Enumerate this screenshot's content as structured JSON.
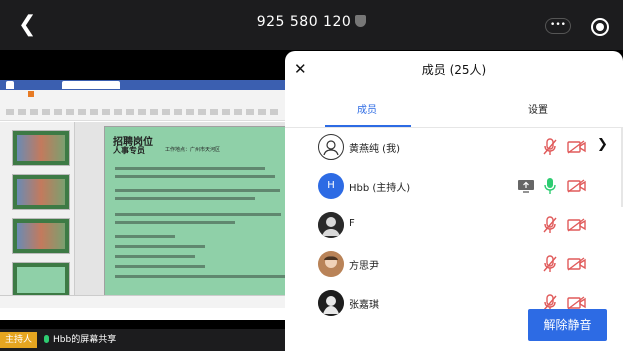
{
  "topbar": {
    "meeting_id": "925 580 120",
    "more_label": "•••"
  },
  "share": {
    "host_badge": "主持人",
    "share_text": "Hbb的屏幕共享",
    "slide": {
      "title": "招聘岗位",
      "subtitle": "人事专员",
      "location": "工作地点：广州市天河区"
    }
  },
  "panel": {
    "title": "成员 (25人)",
    "tabs": [
      {
        "label": "成员"
      },
      {
        "label": "设置"
      }
    ],
    "members": [
      {
        "name": "黄燕纯 (我)",
        "avatar_text": "",
        "mic": "off",
        "camera": "off",
        "sharing": false,
        "has_chevron": true
      },
      {
        "name": "Hbb (主持人)",
        "avatar_text": "H",
        "mic": "on",
        "camera": "off",
        "sharing": true,
        "has_chevron": false
      },
      {
        "name": "F",
        "avatar_text": "",
        "mic": "off",
        "camera": "off",
        "sharing": false,
        "has_chevron": false
      },
      {
        "name": "方思尹",
        "avatar_text": "",
        "mic": "off",
        "camera": "off",
        "sharing": false,
        "has_chevron": false
      },
      {
        "name": "张嘉琪",
        "avatar_text": "",
        "mic": "off",
        "camera": "off",
        "sharing": false,
        "has_chevron": false
      }
    ],
    "unmute_label": "解除静音"
  },
  "colors": {
    "accent": "#2d6be4",
    "muted_red": "#e05a5a",
    "mic_on_green": "#2ecc71",
    "host_badge": "#e5a520"
  },
  "icons": {
    "back": "back-arrow-icon",
    "shield": "shield-icon",
    "more": "more-options-icon",
    "record": "record-icon",
    "close": "close-icon",
    "mic_off": "microphone-muted-icon",
    "mic_on": "microphone-icon",
    "camera_off": "camera-off-icon",
    "screen_share": "screen-share-icon",
    "chevron": "chevron-right-icon"
  }
}
